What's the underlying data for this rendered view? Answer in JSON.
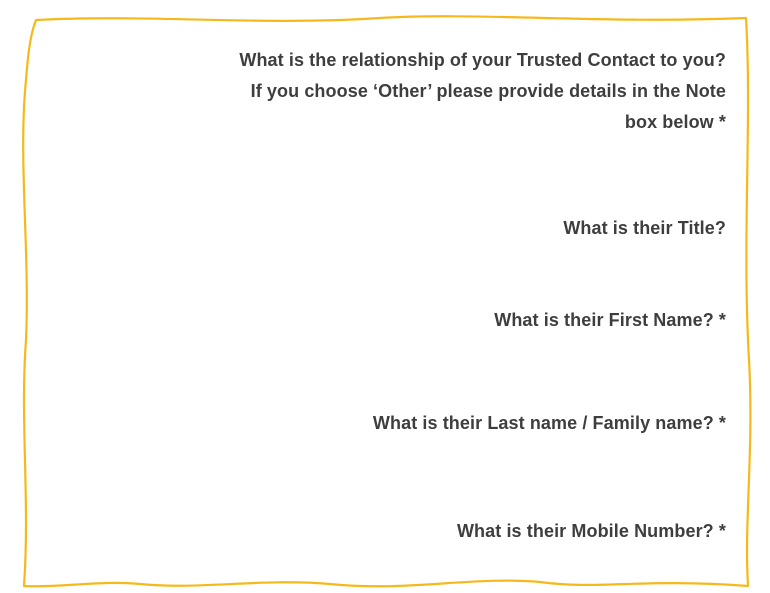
{
  "form": {
    "questions": {
      "relationship": {
        "line1": "What is the relationship of your Trusted Contact to you?",
        "line2": "If you choose ‘Other’ please provide details in the Note",
        "line3": "box below *"
      },
      "title": "What is their Title?",
      "first_name": "What is their First Name? *",
      "last_name": "What is their Last name / Family name? *",
      "mobile": "What is their Mobile Number? *"
    }
  },
  "colors": {
    "frame_border": "#f5b91c",
    "label_text": "#3e3e3e",
    "background": "#ffffff"
  }
}
